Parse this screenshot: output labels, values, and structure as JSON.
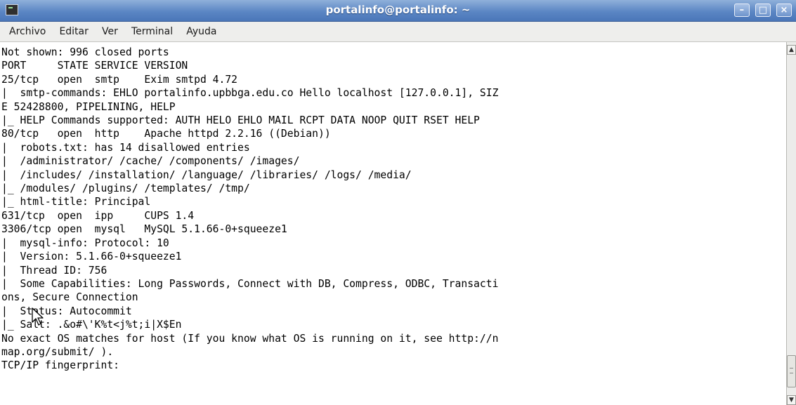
{
  "window": {
    "title": "portalinfo@portalinfo: ~",
    "icon": "terminal-icon",
    "controls": {
      "minimize": "–",
      "maximize": "□",
      "close": "×"
    }
  },
  "menu": {
    "items": [
      "Archivo",
      "Editar",
      "Ver",
      "Terminal",
      "Ayuda"
    ]
  },
  "terminal": {
    "lines": [
      "Not shown: 996 closed ports",
      "PORT     STATE SERVICE VERSION",
      "25/tcp   open  smtp    Exim smtpd 4.72",
      "|  smtp-commands: EHLO portalinfo.upbbga.edu.co Hello localhost [127.0.0.1], SIZ",
      "E 52428800, PIPELINING, HELP",
      "|_ HELP Commands supported: AUTH HELO EHLO MAIL RCPT DATA NOOP QUIT RSET HELP",
      "80/tcp   open  http    Apache httpd 2.2.16 ((Debian))",
      "|  robots.txt: has 14 disallowed entries",
      "|  /administrator/ /cache/ /components/ /images/",
      "|  /includes/ /installation/ /language/ /libraries/ /logs/ /media/",
      "|_ /modules/ /plugins/ /templates/ /tmp/",
      "|_ html-title: Principal",
      "631/tcp  open  ipp     CUPS 1.4",
      "3306/tcp open  mysql   MySQL 5.1.66-0+squeeze1",
      "|  mysql-info: Protocol: 10",
      "|  Version: 5.1.66-0+squeeze1",
      "|  Thread ID: 756",
      "|  Some Capabilities: Long Passwords, Connect with DB, Compress, ODBC, Transacti",
      "ons, Secure Connection",
      "|  Status: Autocommit",
      "|_ Salt: .&o#\\'K%t<j%t;i|X$En",
      "No exact OS matches for host (If you know what OS is running on it, see http://n",
      "map.org/submit/ ).",
      "TCP/IP fingerprint:"
    ]
  }
}
